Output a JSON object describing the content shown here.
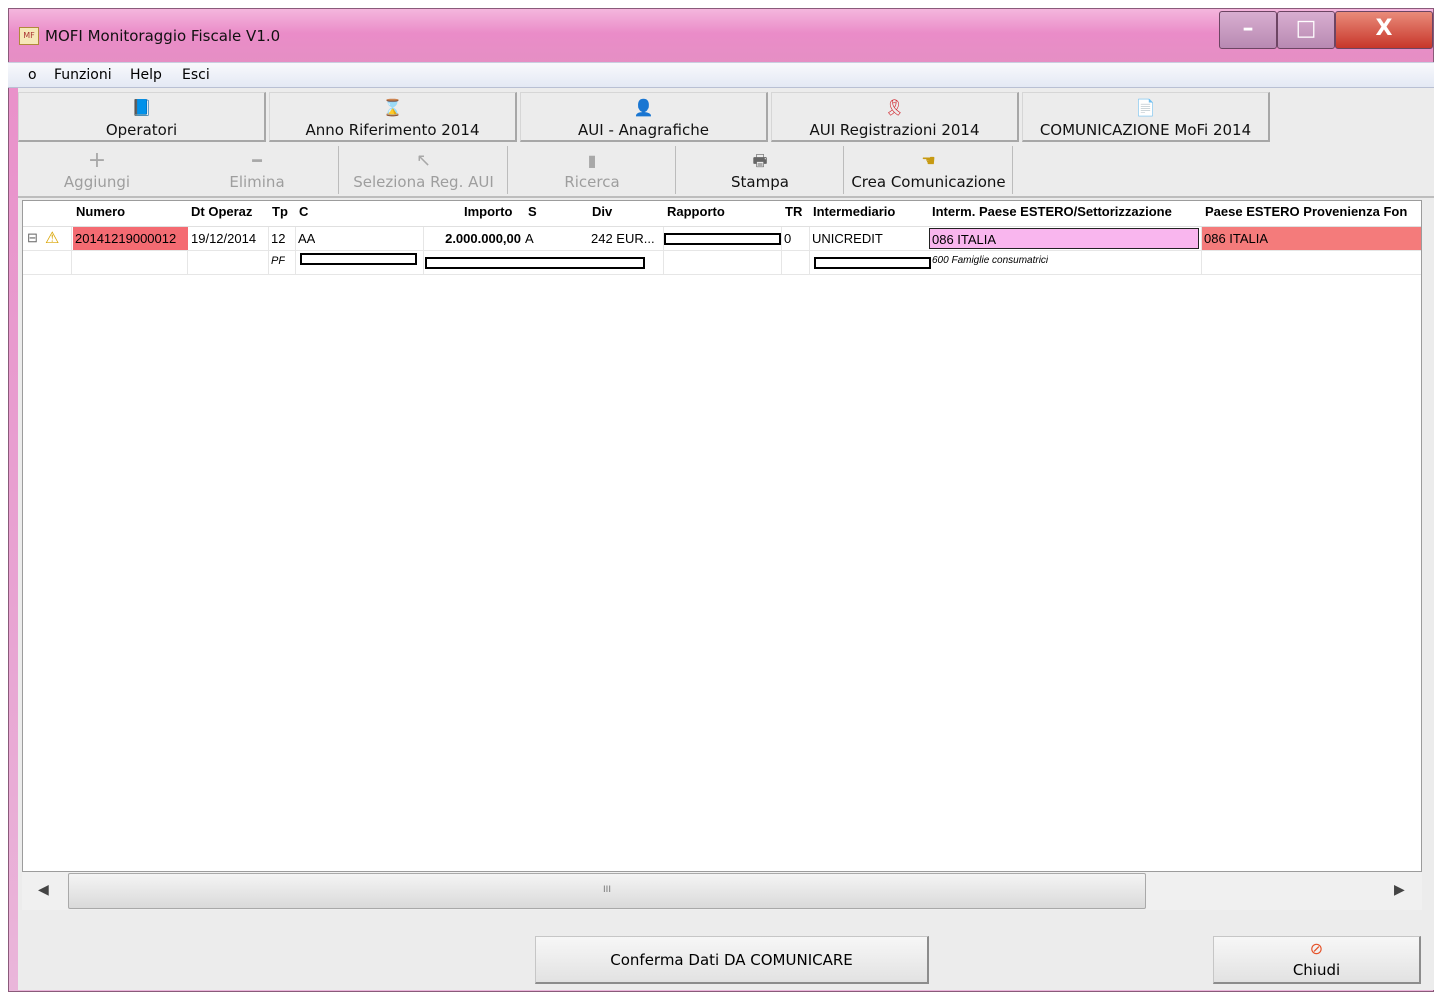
{
  "window": {
    "title": "MOFI Monitoraggio Fiscale V1.0",
    "app_icon_text": "MF",
    "controls": {
      "minimize": "–",
      "maximize": "□",
      "close": "X"
    }
  },
  "menu": {
    "items": [
      "o",
      "Funzioni",
      "Help",
      "Esci"
    ]
  },
  "toolbar_main": [
    {
      "label": "Operatori",
      "icon": "book-icon",
      "glyph": "📘"
    },
    {
      "label": "Anno Riferimento 2014",
      "icon": "hourglass-icon",
      "glyph": "⌛"
    },
    {
      "label": "AUI - Anagrafiche",
      "icon": "user-icon",
      "glyph": "👤"
    },
    {
      "label": "AUI Registrazioni 2014",
      "icon": "ribbon-icon",
      "glyph": "🎗"
    },
    {
      "label": "COMUNICAZIONE MoFi 2014",
      "icon": "document-copy-icon",
      "glyph": "📄"
    }
  ],
  "toolbar_secondary": [
    {
      "label": "Aggiungi",
      "icon": "plus-icon",
      "glyph": "+",
      "enabled": false
    },
    {
      "label": "Elimina",
      "icon": "minus-icon",
      "glyph": "━",
      "enabled": false
    },
    {
      "label": "Seleziona Reg. AUI",
      "icon": "cursor-icon",
      "glyph": "↖",
      "enabled": false
    },
    {
      "label": "Ricerca",
      "icon": "page-icon",
      "glyph": "▮",
      "enabled": false
    },
    {
      "label": "Stampa",
      "icon": "printer-icon",
      "glyph": "🖶",
      "enabled": true
    },
    {
      "label": "Crea Comunicazione",
      "icon": "pointing-hand-icon",
      "glyph": "☚",
      "enabled": true
    }
  ],
  "grid": {
    "columns": [
      "Numero",
      "Dt Operaz",
      "Tp",
      "C",
      "Importo",
      "S",
      "Div",
      "Rapporto",
      "TR",
      "Intermediario",
      "Interm. Paese ESTERO/Settorizzazione",
      "Paese ESTERO Provenienza Fon"
    ],
    "row": {
      "expand": "⊟",
      "warning": "⚠",
      "numero": "20141219000012",
      "dt_operaz": "19/12/2014",
      "tp": "12",
      "c": "AA",
      "importo": "2.000.000,00",
      "s": "A",
      "div": "242 EUR...",
      "tr": "0",
      "intermediario": "UNICREDIT",
      "interm_paese": "086 ITALIA",
      "paese_provenienza": "086 ITALIA",
      "sub_tp": "PF",
      "sub_settorizzazione": "600 Famiglie consumatrici"
    }
  },
  "scrollbar": {
    "left_arrow": "◀",
    "right_arrow": "▶",
    "grip": "III"
  },
  "buttons": {
    "confirm": "Conferma Dati DA COMUNICARE",
    "close": "Chiudi",
    "close_icon": "⊘"
  },
  "colors": {
    "numero_bg": "#f46b72",
    "interm_bg": "#f9b6ee",
    "paese_bg": "#f47b7b"
  }
}
